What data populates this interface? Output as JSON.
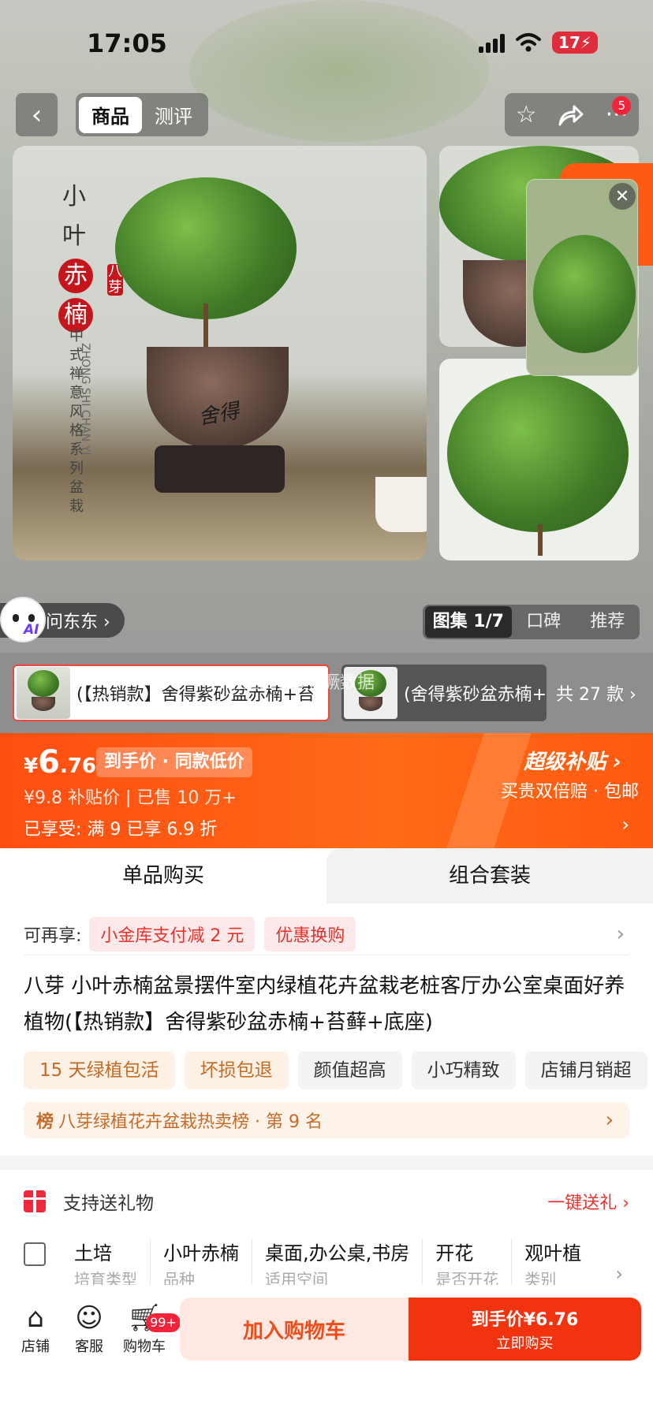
{
  "status_bar": {
    "time": "17:05",
    "battery": "17"
  },
  "nav": {
    "tabs": [
      {
        "label": "商品"
      },
      {
        "label": "测评"
      }
    ],
    "notification_count": "5"
  },
  "gallery": {
    "main_text": {
      "title": [
        "小",
        "叶",
        "赤",
        "楠"
      ],
      "subtitle": "中式禅意风格系列盆栽",
      "brand_badge": "八芽",
      "pinyin": "ZHONG SHI CHAN YI",
      "pot_mark": "舍得"
    },
    "ai_badge": "AI",
    "ai_label": "问东东 ›",
    "tabs": [
      {
        "label": "图集 1/7"
      },
      {
        "label": "口碑"
      },
      {
        "label": "推荐"
      }
    ]
  },
  "sku": {
    "selected_label": "(【热销款】舍得紫砂盆赤楠+苔",
    "other_label": "(舍得紫砂盆赤楠+",
    "count_label": "共 27 款 ›",
    "overlay_text": "刚坐上top老獗数据"
  },
  "price": {
    "currency": "¥",
    "integer": "6",
    "decimal": ".76",
    "tag": "到手价 · 同款低价",
    "sub": "¥9.8 补贴价  |  已售 10 万+",
    "enjoy": "已享受: 满 9 已享 6.9 折",
    "subsidy_title": "超级补贴 ›",
    "subsidy_desc": "买贵双倍赔 · 包邮"
  },
  "buy_tabs": [
    {
      "label": "单品购买"
    },
    {
      "label": "组合套装"
    }
  ],
  "promo": {
    "label": "可再享:",
    "coupons": [
      {
        "label": "小金库支付减 2 元"
      },
      {
        "label": "优惠换购"
      }
    ]
  },
  "product": {
    "title": "八芽 小叶赤楠盆景摆件室内绿植花卉盆栽老桩客厅办公室桌面好养植物(【热销款】舍得紫砂盆赤楠+苔藓+底座)",
    "tags": [
      {
        "label": "15 天绿植包活",
        "style": "warm"
      },
      {
        "label": "坏损包退",
        "style": "warm"
      },
      {
        "label": "颜值超高",
        "style": "gray"
      },
      {
        "label": "小巧精致",
        "style": "gray"
      },
      {
        "label": "店铺月销超",
        "style": "gray"
      }
    ],
    "rank_icon": "榜",
    "rank_text": "八芽绿植花卉盆栽热卖榜 · 第 9 名"
  },
  "gift": {
    "label": "支持送礼物",
    "link": "一键送礼 ›"
  },
  "specs": [
    {
      "value": "土培",
      "key": "培育类型"
    },
    {
      "value": "小叶赤楠",
      "key": "品种"
    },
    {
      "value": "桌面,办公桌,书房",
      "key": "适用空间"
    },
    {
      "value": "开花",
      "key": "是否开花"
    },
    {
      "value": "观叶植",
      "key": "类别"
    }
  ],
  "bottom_bar": {
    "shop_label": "店铺",
    "service_label": "客服",
    "cart_label": "购物车",
    "cart_badge": "99+",
    "add_cart": "加入购物车",
    "buy_price": "到手价¥6.76",
    "buy_now": "立即购买"
  },
  "colors": {
    "accent": "#ff5a14",
    "buy_button": "#f2330f",
    "coupon_red": "#e8322b"
  }
}
